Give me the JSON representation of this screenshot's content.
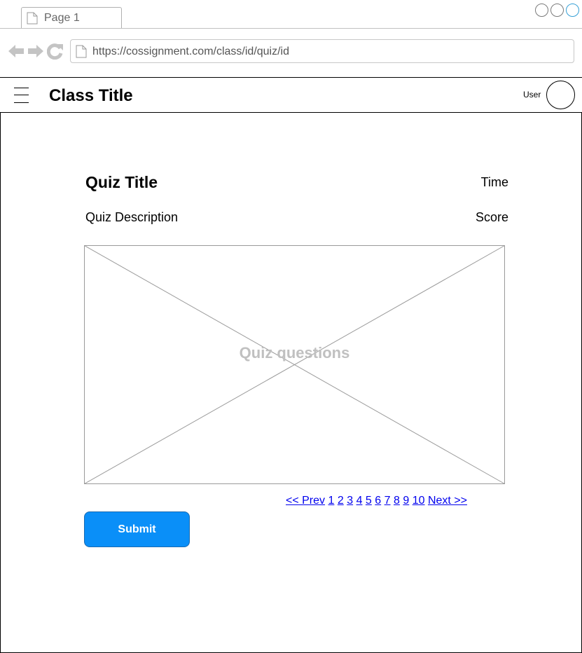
{
  "browser": {
    "tab_title": "Page 1",
    "url": "https://cossignment.com/class/id/quiz/id"
  },
  "header": {
    "class_title": "Class Title",
    "user_label": "User"
  },
  "quiz": {
    "title": "Quiz Title",
    "time_label": "Time",
    "description": "Quiz Description",
    "score_label": "Score",
    "questions_placeholder": "Quiz questions"
  },
  "pagination": {
    "prev": "<< Prev",
    "pages": [
      "1",
      "2",
      "3",
      "4",
      "5",
      "6",
      "7",
      "8",
      "9",
      "10"
    ],
    "next": "Next >>"
  },
  "actions": {
    "submit_label": "Submit"
  },
  "colors": {
    "submit_bg": "#0a8ff8",
    "link": "#0000ee",
    "placeholder_text": "#c0c0c0"
  }
}
